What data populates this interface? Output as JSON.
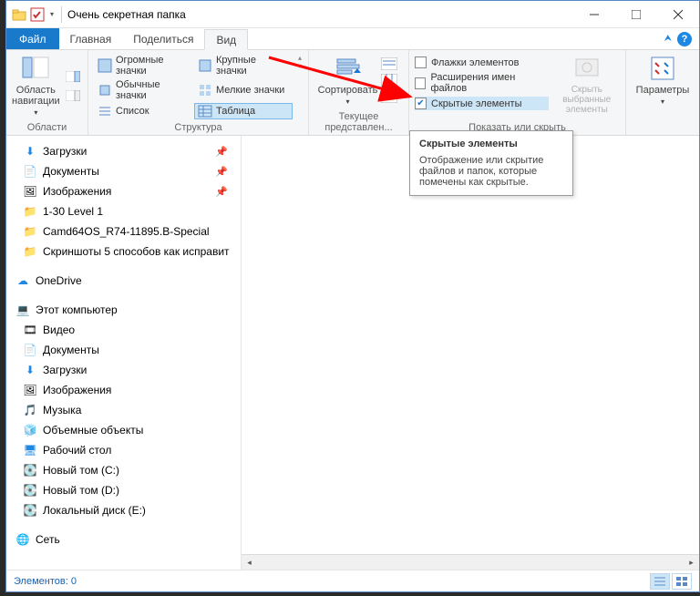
{
  "title": "Очень секретная папка",
  "menu": {
    "file": "Файл",
    "home": "Главная",
    "share": "Поделиться",
    "view": "Вид"
  },
  "ribbon": {
    "groups": {
      "panes": {
        "nav_area": "Область навигации",
        "label": "Области"
      },
      "layout": {
        "huge": "Огромные значки",
        "large": "Крупные значки",
        "normal": "Обычные значки",
        "small": "Мелкие значки",
        "list": "Список",
        "table": "Таблица",
        "label": "Структура"
      },
      "current": {
        "sort": "Сортировать",
        "label": "Текущее представлен..."
      },
      "show": {
        "checkboxes": "Флажки элементов",
        "extensions": "Расширения имен файлов",
        "hidden": "Скрытые элементы",
        "hide_sel": "Скрыть выбранные элементы",
        "label": "Показать или скрыть"
      },
      "options": {
        "btn": "Параметры"
      }
    }
  },
  "tooltip": {
    "title": "Скрытые элементы",
    "body": "Отображение или скрытие файлов и папок, которые помечены как скрытые."
  },
  "tree": {
    "downloads": "Загрузки",
    "documents": "Документы",
    "pictures": "Изображения",
    "f1": "1-30 Level 1",
    "f2": "Camd64OS_R74-11895.B-Special",
    "f3": "Скриншоты 5 способов как исправит",
    "onedrive": "OneDrive",
    "thispc": "Этот компьютер",
    "videos": "Видео",
    "documents2": "Документы",
    "downloads2": "Загрузки",
    "pictures2": "Изображения",
    "music": "Музыка",
    "objects3d": "Объемные объекты",
    "desktop": "Рабочий стол",
    "volc": "Новый том (C:)",
    "vold": "Новый том (D:)",
    "vole": "Локальный диск (E:)",
    "network": "Сеть"
  },
  "status": {
    "items": "Элементов: 0"
  }
}
